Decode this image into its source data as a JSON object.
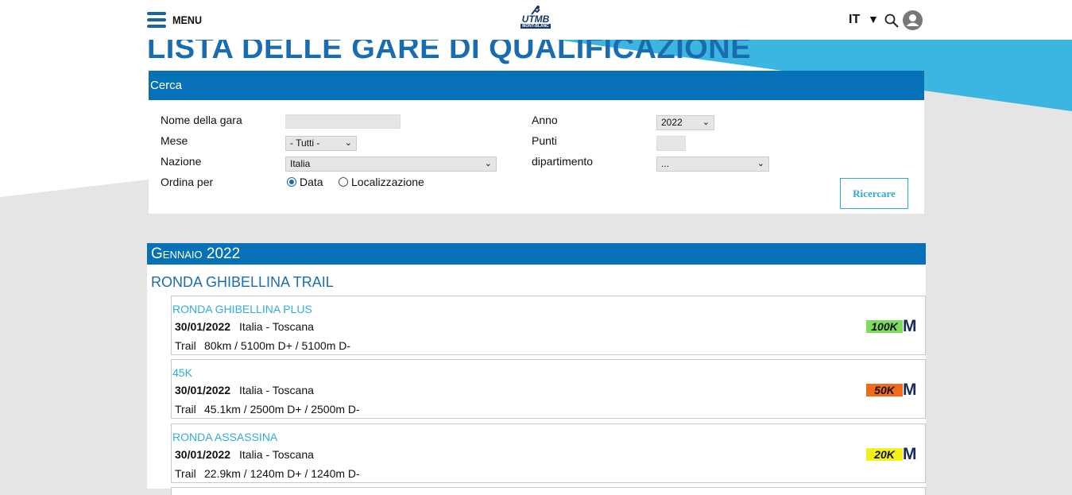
{
  "header": {
    "menu_label": "MENU",
    "logo_text": "UTMB",
    "logo_sub": "MONT-BLANC",
    "language": "IT",
    "language_arrow": "▼"
  },
  "page": {
    "title": "LISTA DELLE GARE DI QUALIFICAZIONE"
  },
  "search": {
    "header": "Cerca",
    "fields": {
      "race_name_label": "Nome della gara",
      "race_name_value": "",
      "month_label": "Mese",
      "month_value": "- Tutti -",
      "country_label": "Nazione",
      "country_value": "Italia",
      "sort_label": "Ordina per",
      "sort_option_date": "Data",
      "sort_option_location": "Localizzazione",
      "sort_selected": "Data",
      "year_label": "Anno",
      "year_value": "2022",
      "points_label": "Punti",
      "points_value": "",
      "department_label": "dipartimento",
      "department_value": "..."
    },
    "button_label": "Ricercare"
  },
  "results": {
    "month_header": "Gennaio 2022",
    "event_title": "RONDA GHIBELLINA TRAIL",
    "races": [
      {
        "name": "RONDA GHIBELLINA PLUS",
        "date": "30/01/2022",
        "location": "Italia - Toscana",
        "type": "Trail",
        "stats": "80km / 5100m D+ / 5100m D-",
        "badge": "100K",
        "badge_color": "#7ddc5a"
      },
      {
        "name": "45K",
        "date": "30/01/2022",
        "location": "Italia - Toscana",
        "type": "Trail",
        "stats": "45.1km / 2500m D+ / 2500m D-",
        "badge": "50K",
        "badge_color": "#f26b1d"
      },
      {
        "name": "RONDA ASSASSINA",
        "date": "30/01/2022",
        "location": "Italia - Toscana",
        "type": "Trail",
        "stats": "22.9km / 1240m D+ / 1240m D-",
        "badge": "20K",
        "badge_color": "#f5f01a"
      }
    ],
    "badge_suffix": "M"
  },
  "colors": {
    "primary_blue": "#0771b8",
    "title_blue": "#1a6cb0",
    "accent_cyan": "#33aadd",
    "background_gray": "#e5e5e5"
  }
}
